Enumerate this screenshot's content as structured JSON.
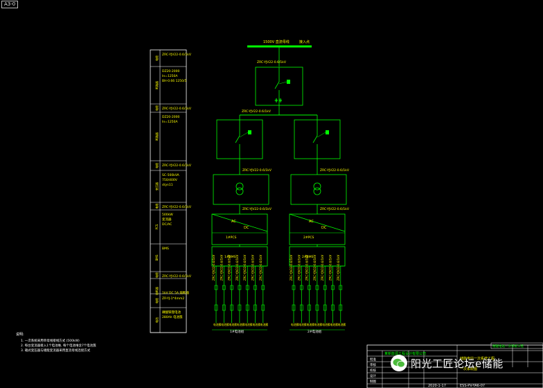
{
  "sheet_tag": "A3-0",
  "busbar": {
    "label": "1500V 直流母线",
    "tap_label": "接入点"
  },
  "left_table": {
    "rows": [
      {
        "group": "电缆",
        "text": [
          "ZRC-YJV22-0.6/1kV"
        ]
      },
      {
        "group": "断路器",
        "text": [
          "DZ20-2000",
          "In=1250A",
          "BH-0.66 1250/5"
        ]
      },
      {
        "group": "电缆",
        "text": [
          "ZRC-YJV22-0.6/1kV"
        ]
      },
      {
        "group": "断路器",
        "text": [
          "DZ20-2000",
          "In=1250A"
        ]
      },
      {
        "group": "电缆",
        "text": [
          "ZRC-YJV22-0.6/1kV"
        ]
      },
      {
        "group": "变压器",
        "text": [
          "SC-500kVA",
          "750/400V",
          "d/yn11"
        ]
      },
      {
        "group": "电缆",
        "text": [
          "ZRC-YJV22-0.6/1kV"
        ]
      },
      {
        "group": "PCS",
        "text": [
          "500kW",
          "变流器",
          "DC/AC"
        ]
      },
      {
        "group": "BMS",
        "text": [
          "BMS"
        ]
      },
      {
        "group": "电缆",
        "text": [
          "ZRC-YJV22-0.6/1kV"
        ]
      },
      {
        "group": "熔断器",
        "text": [
          "1kV DC 5A 熔断器"
        ]
      },
      {
        "group": "电缆",
        "text": [
          "ZR-YJ-1*4mm2"
        ]
      },
      {
        "group": "电池",
        "text": [
          "磷酸铁锂电池",
          "280Ah 电池簇"
        ]
      }
    ]
  },
  "branches": [
    {
      "pcs_label": "1#PCS",
      "bms_label": "1#BMS",
      "cluster_caption": "1#电池组"
    },
    {
      "pcs_label": "2#PCS",
      "bms_label": "2#BMS",
      "cluster_caption": "2#电池组"
    }
  ],
  "cluster_tag": "电池簇",
  "pcs_symbols": {
    "ac": "AC",
    "dc": "DC"
  },
  "notes": {
    "title": "说明:",
    "items": [
      "1. 一次系统采用单母线接线方式 (500kW)",
      "2. 每台变流器接入1个电池堆, 每个电池堆含7个电池簇",
      "3. 箱式变压器与储能变流器采用直流母线连接方式"
    ]
  },
  "title_block": {
    "company": "某新能源工程设计有限公司",
    "project": "储能电站一次系统工程",
    "drawing_name": "一次系统图",
    "drawing_no": "ESS-PV-YA6-07",
    "date": "2020-1-17",
    "row_labels": [
      "批准",
      "审核",
      "校核",
      "设计",
      "制图"
    ]
  },
  "watermark": "阳光工匠论坛e储能",
  "colors": {
    "line": "#00ff00",
    "text": "#ffff00",
    "frame": "#ffffff",
    "bus": "#00ff00"
  }
}
